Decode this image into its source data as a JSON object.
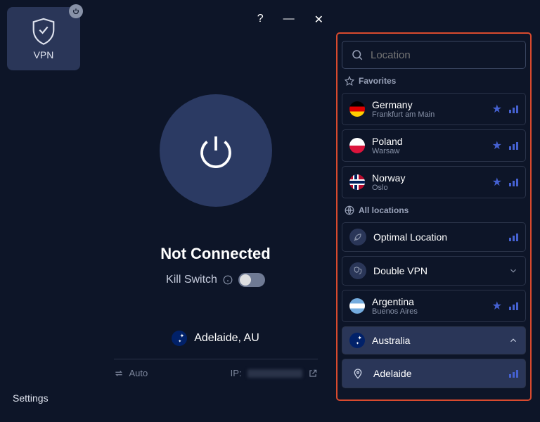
{
  "sidebar": {
    "vpn_label": "VPN",
    "settings_label": "Settings"
  },
  "titlebar": {
    "help": "?",
    "minimize": "—",
    "close": "✕"
  },
  "main": {
    "status": "Not Connected",
    "kill_switch_label": "Kill Switch",
    "current_location": "Adelaide, AU",
    "protocol_label": "Auto",
    "ip_label": "IP:"
  },
  "panel": {
    "search_placeholder": "Location",
    "favorites_header": "Favorites",
    "all_locations_header": "All locations",
    "favorites": [
      {
        "name": "Germany",
        "city": "Frankfurt am Main",
        "flag": "de"
      },
      {
        "name": "Poland",
        "city": "Warsaw",
        "flag": "pl"
      },
      {
        "name": "Norway",
        "city": "Oslo",
        "flag": "no"
      }
    ],
    "optimal_label": "Optimal Location",
    "double_vpn_label": "Double VPN",
    "locations": [
      {
        "name": "Argentina",
        "city": "Buenos Aires",
        "flag": "ar"
      }
    ],
    "expanded": {
      "name": "Australia",
      "flag": "au",
      "children": [
        {
          "name": "Adelaide"
        }
      ]
    }
  }
}
